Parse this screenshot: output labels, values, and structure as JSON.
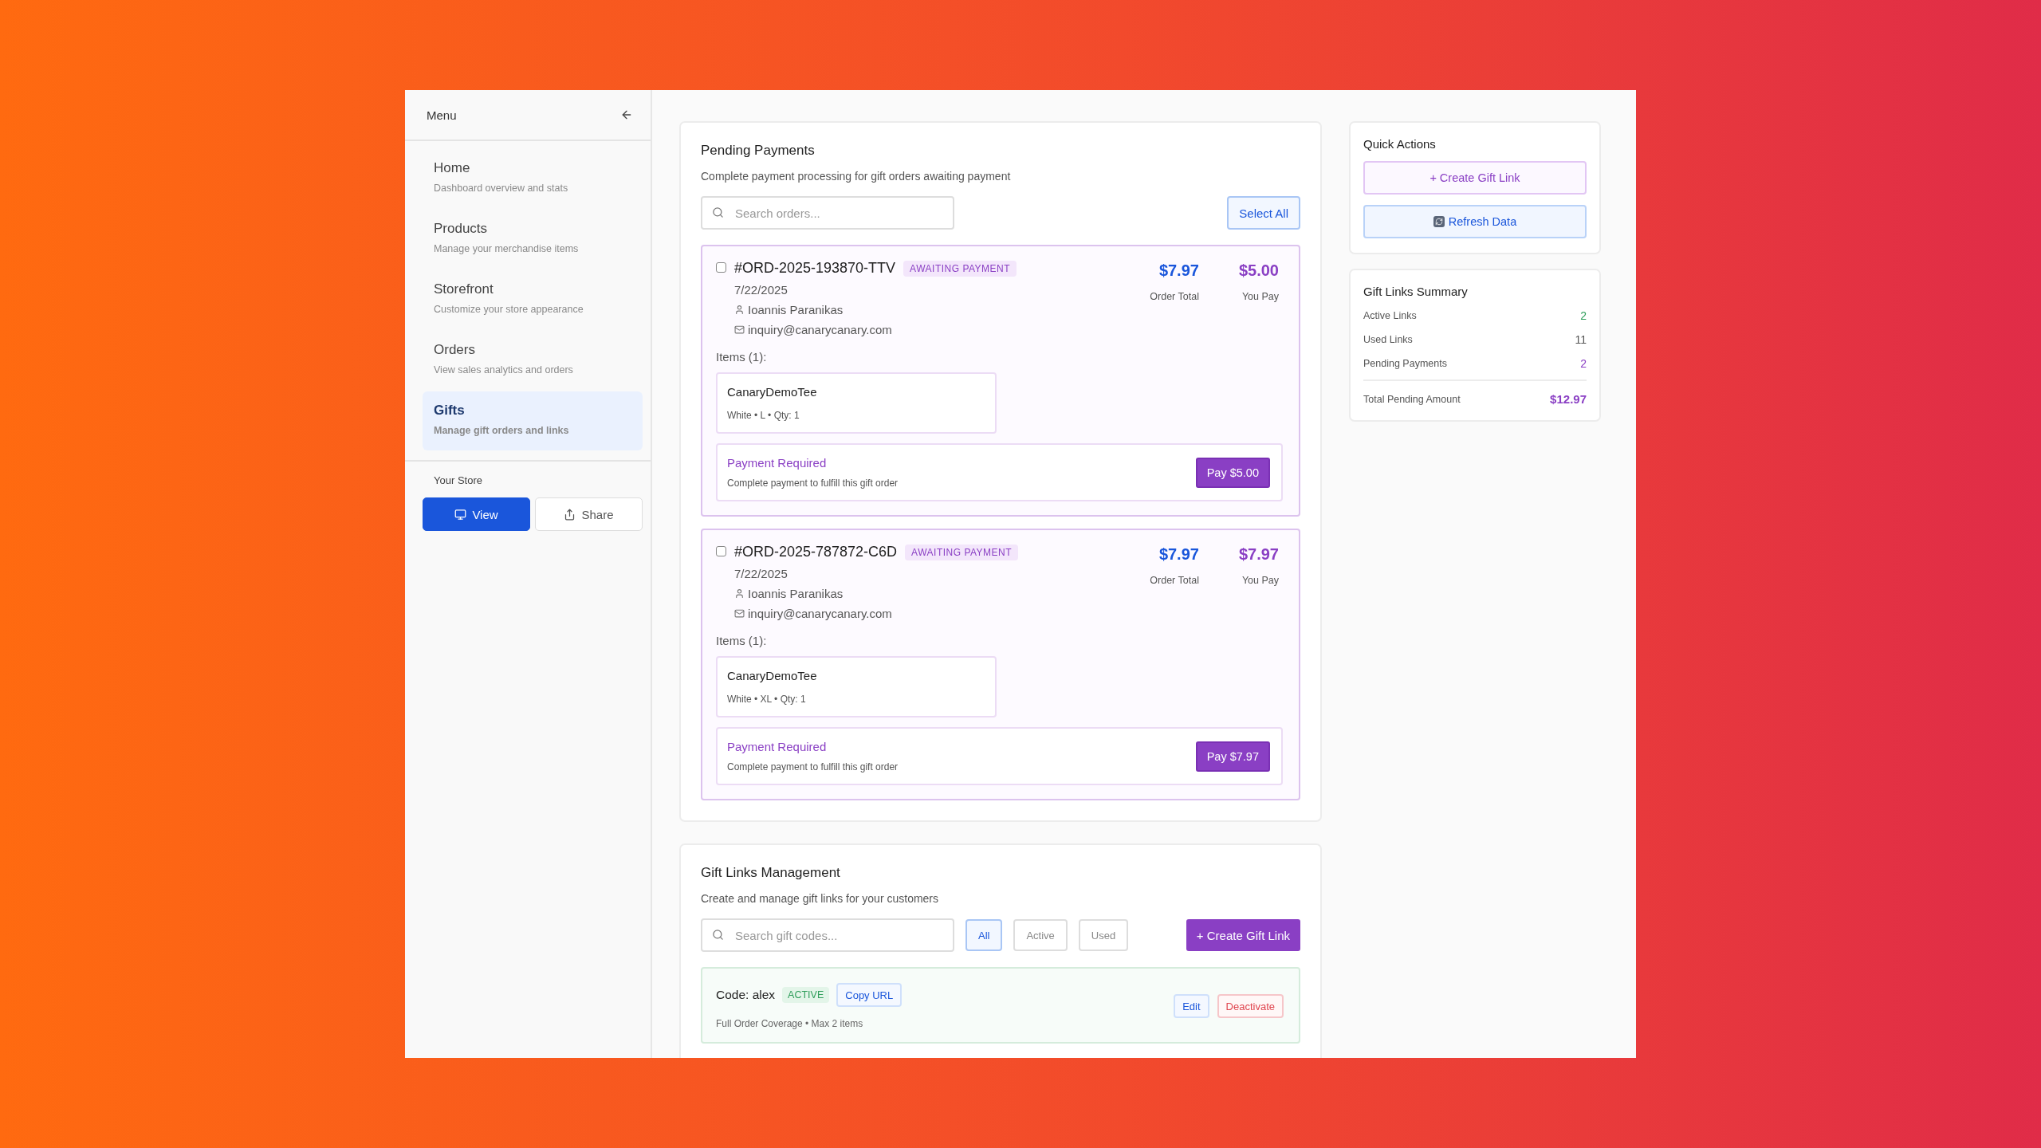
{
  "sidebar": {
    "title": "Menu",
    "items": [
      {
        "label": "Home",
        "description": "Dashboard overview and stats",
        "selected": false
      },
      {
        "label": "Products",
        "description": "Manage your merchandise items",
        "selected": false
      },
      {
        "label": "Storefront",
        "description": "Customize your store appearance",
        "selected": false
      },
      {
        "label": "Orders",
        "description": "View sales analytics and orders",
        "selected": false
      },
      {
        "label": "Gifts",
        "description": "Manage gift orders and links",
        "selected": true
      }
    ],
    "store_label": "Your Store",
    "buttons": [
      {
        "label": "View",
        "kind": "primary"
      },
      {
        "label": "Share",
        "kind": "secondary"
      }
    ]
  },
  "pending_payments": {
    "title": "Pending Payments",
    "subtitle": "Complete payment processing for gift orders awaiting payment",
    "search": {
      "placeholder": "Search orders..."
    },
    "select_all": "Select All",
    "orders": [
      {
        "number": "#ORD-2025-193870-TTV",
        "status": "AWAITING PAYMENT",
        "checked": false,
        "date": "7/22/2025",
        "customer": "Ioannis Paranikas",
        "email": "inquiry@canarycanary.com",
        "total": "$7.97",
        "total_label": "Order Total",
        "you_pay": "$5.00",
        "you_pay_label": "You Pay",
        "items_label": "Items (1):",
        "items": [
          {
            "name": "CanaryDemoTee",
            "details": "White • L • Qty: 1"
          }
        ],
        "notice_title": "Payment Required",
        "notice_text": "Complete payment to fulfill this gift order",
        "pay_button": "Pay $5.00"
      },
      {
        "number": "#ORD-2025-787872-C6D",
        "status": "AWAITING PAYMENT",
        "checked": false,
        "date": "7/22/2025",
        "customer": "Ioannis Paranikas",
        "email": "inquiry@canarycanary.com",
        "total": "$7.97",
        "total_label": "Order Total",
        "you_pay": "$7.97",
        "you_pay_label": "You Pay",
        "items_label": "Items (1):",
        "items": [
          {
            "name": "CanaryDemoTee",
            "details": "White • XL • Qty: 1"
          }
        ],
        "notice_title": "Payment Required",
        "notice_text": "Complete payment to fulfill this gift order",
        "pay_button": "Pay $7.97"
      }
    ]
  },
  "gift_links": {
    "title": "Gift Links Management",
    "subtitle": "Create and manage gift links for your customers",
    "search": {
      "placeholder": "Search gift codes..."
    },
    "filters": [
      {
        "label": "All",
        "selected": true
      },
      {
        "label": "Active",
        "selected": false
      },
      {
        "label": "Used",
        "selected": false
      }
    ],
    "create_button": "+ Create Gift Link",
    "links": [
      {
        "code": "Code: alex",
        "status": "ACTIVE",
        "copy_button": "Copy URL",
        "description": "Full Order Coverage • Max 2 items",
        "edit_button": "Edit",
        "deactivate_button": "Deactivate"
      }
    ]
  },
  "quick_actions": {
    "title": "Quick Actions",
    "buttons": [
      {
        "label": "+ Create Gift Link",
        "kind": "create"
      },
      {
        "label": "Refresh Data",
        "kind": "refresh"
      }
    ]
  },
  "summary": {
    "title": "Gift Links Summary",
    "rows": [
      {
        "label": "Active Links",
        "value": "2",
        "color": "#2f9e5b"
      },
      {
        "label": "Used Links",
        "value": "11",
        "color": "#555555"
      },
      {
        "label": "Pending Payments",
        "value": "2",
        "color": "#8a3fc4"
      }
    ],
    "total": {
      "label": "Total Pending Amount",
      "value": "$12.97"
    }
  }
}
